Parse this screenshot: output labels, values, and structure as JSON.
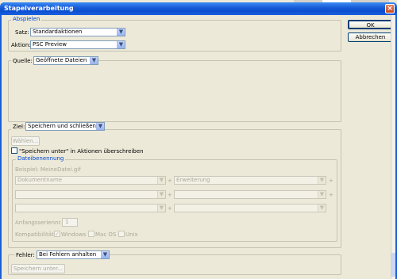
{
  "window": {
    "title": "Stapelverarbeitung"
  },
  "buttons": {
    "ok": "OK",
    "cancel": "Abbrechen",
    "choose": "Wählen...",
    "save_as": "Speichern unter..."
  },
  "play": {
    "legend": "Abspielen",
    "set_label": "Satz:",
    "set_value": "Standardaktionen",
    "action_label": "Aktion:",
    "action_value": "PSC Preview"
  },
  "source": {
    "label": "Quelle:",
    "value": "Geöffnete Dateien"
  },
  "target": {
    "label": "Ziel:",
    "value": "Speichern und schließen",
    "override_label": "\"Speichern unter\" in Aktionen überschreiben"
  },
  "naming": {
    "legend": "Dateibenennung",
    "example": "Beispiel: MeineDatei.gif",
    "row1_left": "Dokumentname",
    "row1_right": "Erweiterung",
    "plus": "+",
    "start_serial_label": "Anfangsseriennr.:",
    "start_serial_value": "1",
    "compat_label": "Kompatibilität:",
    "compat_windows": "Windows",
    "compat_mac": "Mac OS",
    "compat_unix": "Unix"
  },
  "errors": {
    "label": "Fehler:",
    "value": "Bei Fehlern anhalten"
  },
  "icons": {
    "close": "×",
    "dropdown": "▼",
    "check": "✓"
  }
}
